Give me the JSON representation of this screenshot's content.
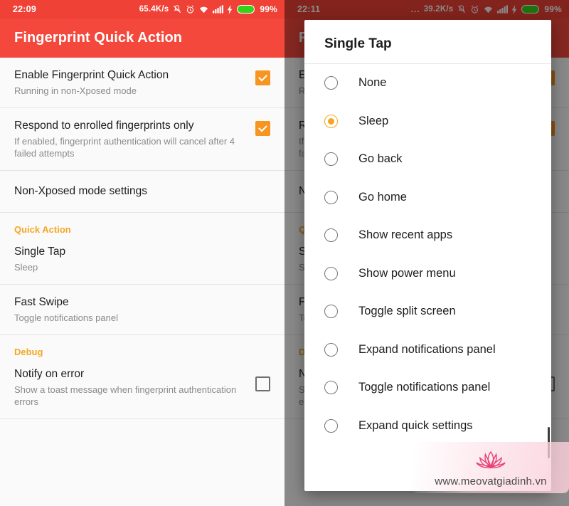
{
  "left": {
    "statusbar": {
      "clock": "22:09",
      "speed": "65.4K/s",
      "icons": [
        "vibrate-off-icon",
        "alarm-icon",
        "wifi-icon",
        "signal-icon",
        "charging-icon",
        "battery-icon"
      ],
      "battery_percent": "99%",
      "bg_color": "#ef4136"
    },
    "appbar": {
      "title": "Fingerprint Quick Action",
      "bg_color": "#f4483c"
    },
    "prefs": [
      {
        "title": "Enable Fingerprint Quick Action",
        "summary": "Running in non-Xposed mode",
        "widget": "checkbox",
        "checked": true
      },
      {
        "title": "Respond to enrolled fingerprints only",
        "summary": "If enabled, fingerprint authentication will cancel after 4 failed attempts",
        "widget": "checkbox",
        "checked": true
      },
      {
        "title": "Non-Xposed mode settings",
        "summary": "",
        "widget": "none",
        "checked": false
      }
    ],
    "category_quick_action": "Quick Action",
    "quick_action_prefs": [
      {
        "title": "Single Tap",
        "summary": "Sleep",
        "widget": "none",
        "checked": false
      },
      {
        "title": "Fast Swipe",
        "summary": "Toggle notifications panel",
        "widget": "none",
        "checked": false
      }
    ],
    "category_debug": "Debug",
    "debug_prefs": [
      {
        "title": "Notify on error",
        "summary": "Show a toast message when fingerprint authentication errors",
        "widget": "checkbox",
        "checked": false
      }
    ]
  },
  "right": {
    "statusbar": {
      "clock": "22:11",
      "dots": "...",
      "speed": "39.2K/s",
      "battery_percent": "99%"
    },
    "dialog": {
      "title": "Single Tap",
      "selected": "Sleep",
      "options": [
        "None",
        "Sleep",
        "Go back",
        "Go home",
        "Show recent apps",
        "Show power menu",
        "Toggle split screen",
        "Expand notifications panel",
        "Toggle notifications panel",
        "Expand quick settings"
      ]
    },
    "watermark": {
      "url": "www.meovatgiadinh.vn",
      "logo": "lotus-icon"
    }
  },
  "colors": {
    "accent_orange": "#f5a623",
    "checkbox_orange": "#f79521",
    "appbar_red": "#f4483c",
    "statusbar_red": "#ef4136",
    "watermark_pink": "#e8417a"
  }
}
